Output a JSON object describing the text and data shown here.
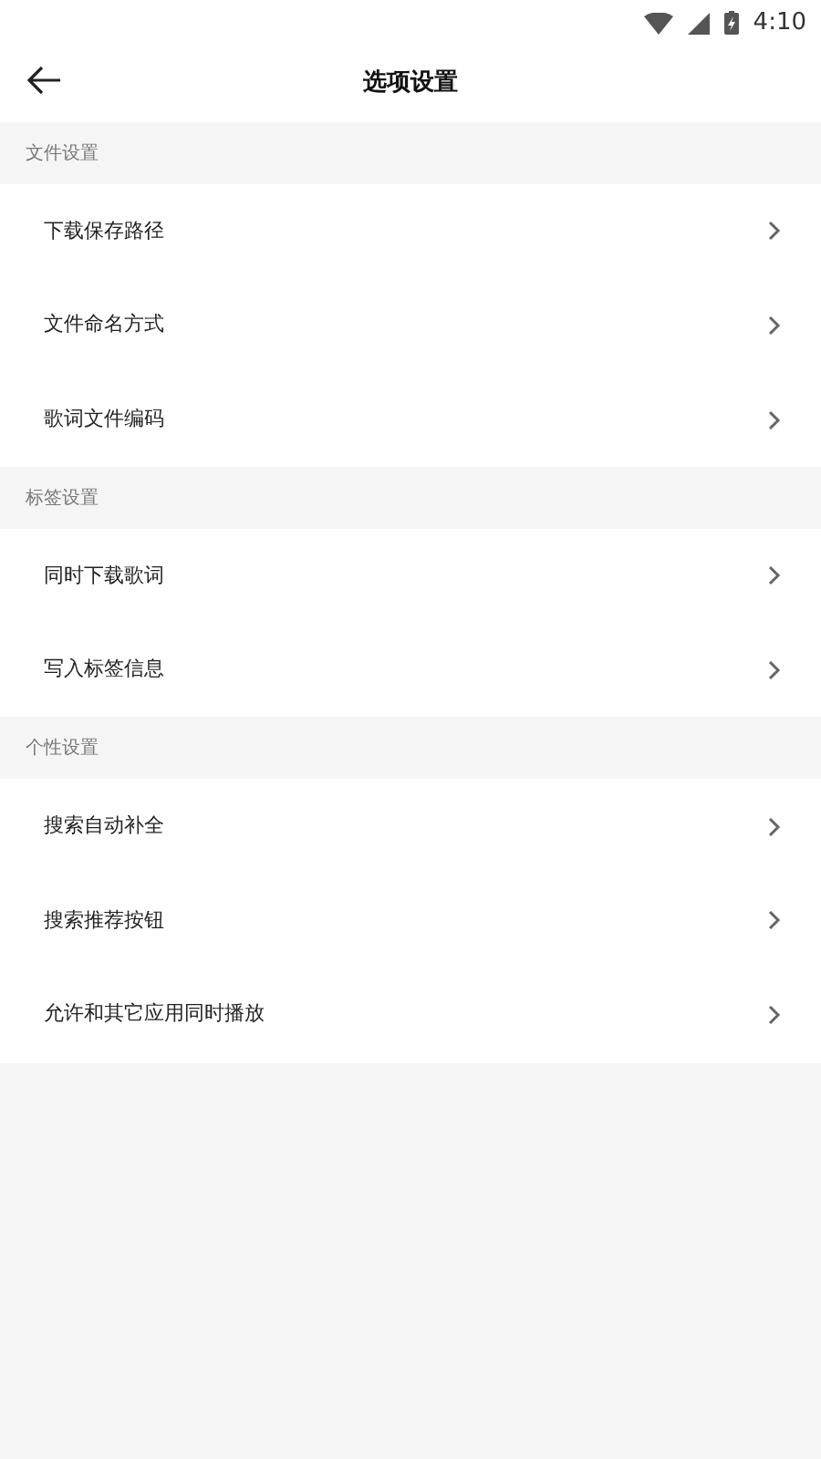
{
  "status_bar": {
    "time": "4:10"
  },
  "header": {
    "title": "选项设置"
  },
  "sections": [
    {
      "title": "文件设置",
      "items": [
        {
          "label": "下载保存路径"
        },
        {
          "label": "文件命名方式"
        },
        {
          "label": "歌词文件编码"
        }
      ]
    },
    {
      "title": "标签设置",
      "items": [
        {
          "label": "同时下载歌词"
        },
        {
          "label": "写入标签信息"
        }
      ]
    },
    {
      "title": "个性设置",
      "items": [
        {
          "label": "搜索自动补全"
        },
        {
          "label": "搜索推荐按钮"
        },
        {
          "label": "允许和其它应用同时播放"
        }
      ]
    }
  ]
}
